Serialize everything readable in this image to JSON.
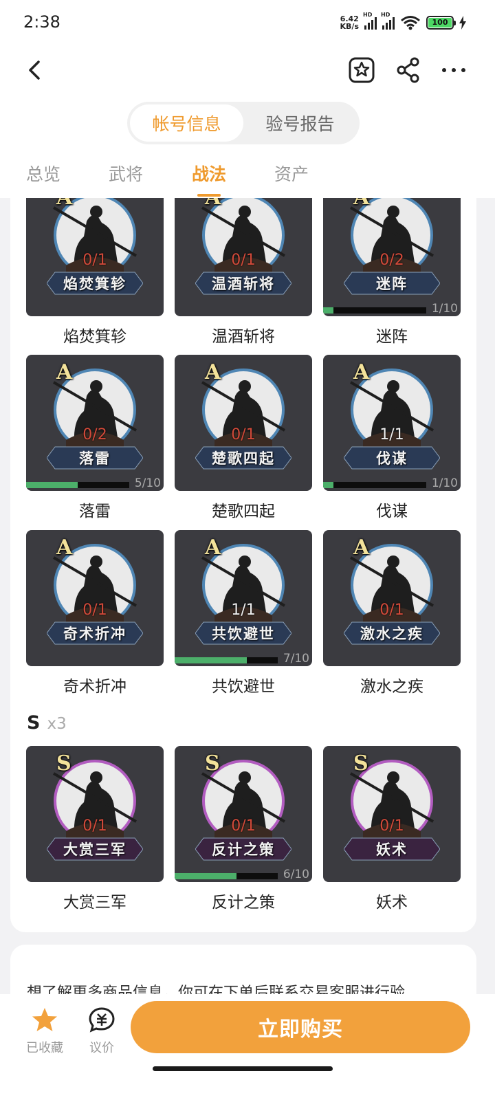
{
  "status": {
    "time": "2:38",
    "net_speed_top": "6.42",
    "net_speed_bottom": "KB/s",
    "hd": "HD",
    "wifi_num": "6",
    "battery": "100"
  },
  "header": {
    "icons": [
      "back-arrow-icon",
      "favorite-star-icon",
      "share-icon",
      "more-icon"
    ],
    "segments": [
      "帐号信息",
      "验号报告"
    ],
    "active_segment": 0
  },
  "tabs": [
    "总览",
    "武将",
    "战法",
    "资产"
  ],
  "active_tab": 2,
  "colors": {
    "accent": "#ef9a2d",
    "button": "#f2a13c",
    "progress": "#4caf6a",
    "ring_a": "#4f86b4",
    "ring_s": "#b25cc0"
  },
  "grid_a": [
    {
      "grade": "A",
      "count": "0/1",
      "banner": "焰焚箕轸",
      "name": "焰焚箕轸"
    },
    {
      "grade": "A",
      "count": "0/1",
      "banner": "温酒斩将",
      "name": "温酒斩将"
    },
    {
      "grade": "A",
      "count": "0/2",
      "banner": "迷阵",
      "name": "迷阵",
      "progress": 0.1,
      "level": "1/10"
    },
    {
      "grade": "A",
      "count": "0/2",
      "banner": "落雷",
      "name": "落雷",
      "progress": 0.5,
      "level": "5/10"
    },
    {
      "grade": "A",
      "count": "0/1",
      "banner": "楚歌四起",
      "name": "楚歌四起"
    },
    {
      "grade": "A",
      "count": "1/1",
      "banner": "伐谋",
      "name": "伐谋",
      "progress": 0.1,
      "level": "1/10"
    },
    {
      "grade": "A",
      "count": "0/1",
      "banner": "奇术折冲",
      "name": "奇术折冲"
    },
    {
      "grade": "A",
      "count": "1/1",
      "banner": "共饮避世",
      "name": "共饮避世",
      "progress": 0.7,
      "level": "7/10"
    },
    {
      "grade": "A",
      "count": "0/1",
      "banner": "激水之疾",
      "name": "激水之疾"
    }
  ],
  "section_s": {
    "label": "S",
    "count": "x3"
  },
  "grid_s": [
    {
      "grade": "S",
      "count": "0/1",
      "banner": "大赏三军",
      "name": "大赏三军"
    },
    {
      "grade": "S",
      "count": "0/1",
      "banner": "反计之策",
      "name": "反计之策",
      "progress": 0.6,
      "level": "6/10"
    },
    {
      "grade": "S",
      "count": "0/1",
      "banner": "妖术",
      "name": "妖术"
    }
  ],
  "info_text": "想了解更多商品信息，你可在下单后联系交易客服进行验",
  "bottom": {
    "fav_label": "已收藏",
    "bargain_label": "议价",
    "buy_label": "立即购买"
  }
}
